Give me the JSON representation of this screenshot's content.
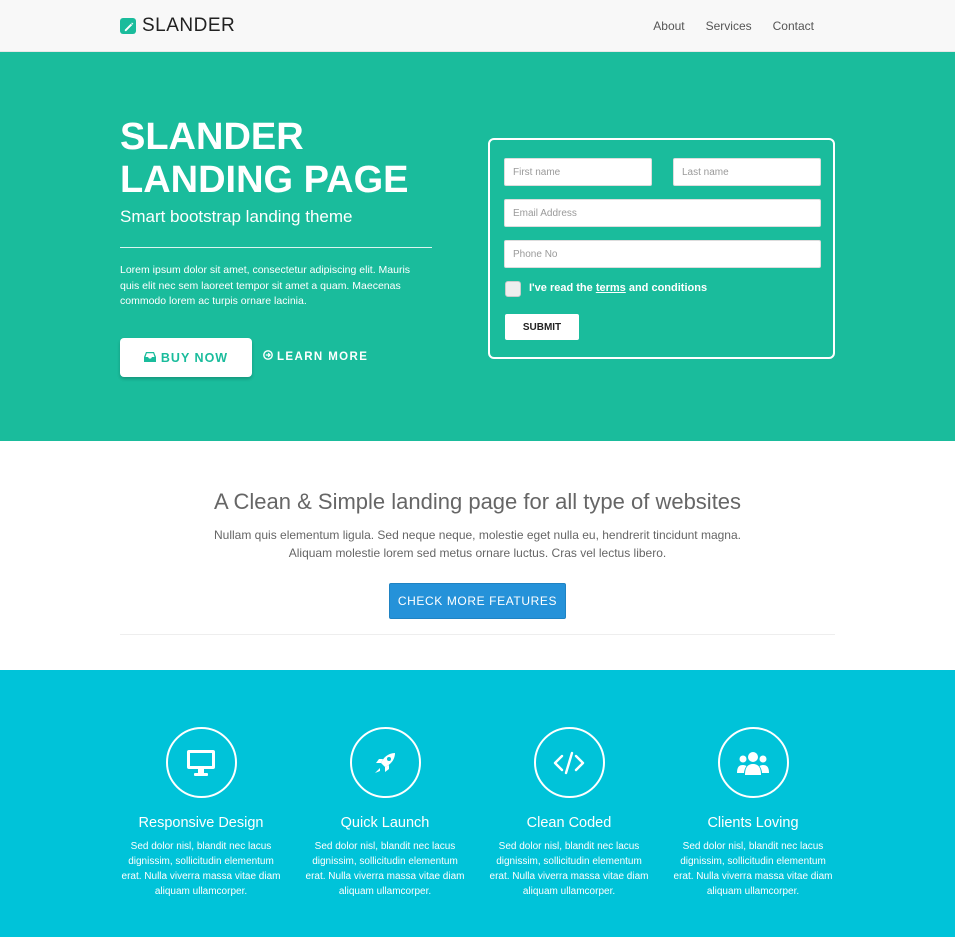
{
  "nav": {
    "brand": "SLANDER",
    "links": [
      "About",
      "Services",
      "Contact"
    ]
  },
  "hero": {
    "title": "SLANDER LANDING PAGE",
    "subtitle": "Smart bootstrap landing theme",
    "paragraph": "Lorem ipsum dolor sit amet, consectetur adipiscing elit. Mauris quis elit nec sem laoreet tempor sit amet a quam. Maecenas commodo lorem ac turpis ornare lacinia.",
    "buy_label": "BUY NOW",
    "learn_label": "LEARN MORE",
    "accent": "#1abc9c"
  },
  "form": {
    "first_name_placeholder": "First name",
    "last_name_placeholder": "Last name",
    "email_placeholder": "Email Address",
    "phone_placeholder": "Phone No",
    "terms_prefix": "I've read the ",
    "terms_link": "terms",
    "terms_suffix": " and conditions",
    "submit_label": "SUBMIT"
  },
  "intro": {
    "title": "A Clean & Simple landing page for all type of websites",
    "line1": "Nullam quis elementum ligula. Sed neque neque, molestie eget nulla eu, hendrerit tincidunt magna.",
    "line2": "Aliquam molestie lorem sed metus ornare luctus. Cras vel lectus libero.",
    "button_label": "CHECK MORE FEATURES"
  },
  "features": {
    "background": "#00c3d9",
    "items": [
      {
        "icon": "desktop-icon",
        "title": "Responsive Design",
        "text": "Sed dolor nisl, blandit nec lacus dignissim, sollicitudin elementum erat. Nulla viverra massa vitae diam aliquam ullamcorper."
      },
      {
        "icon": "rocket-icon",
        "title": "Quick Launch",
        "text": "Sed dolor nisl, blandit nec lacus dignissim, sollicitudin elementum erat. Nulla viverra massa vitae diam aliquam ullamcorper."
      },
      {
        "icon": "code-icon",
        "title": "Clean Coded",
        "text": "Sed dolor nisl, blandit nec lacus dignissim, sollicitudin elementum erat. Nulla viverra massa vitae diam aliquam ullamcorper."
      },
      {
        "icon": "users-icon",
        "title": "Clients Loving",
        "text": "Sed dolor nisl, blandit nec lacus dignissim, sollicitudin elementum erat. Nulla viverra massa vitae diam aliquam ullamcorper."
      }
    ]
  }
}
